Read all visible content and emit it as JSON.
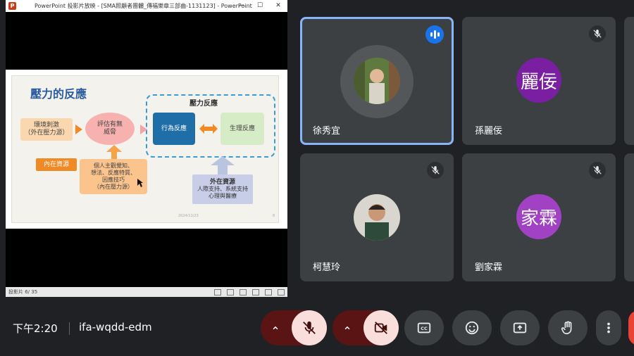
{
  "ppt": {
    "window_title": "PowerPoint 投影片放映 - [SMA照顧者團體_傳福樂章三部曲-1131123] - PowerPoint",
    "win_minimize": "—",
    "win_maximize": "☐",
    "win_close": "✕",
    "status_text": "投影片 6/ 35",
    "slide": {
      "title": "壓力的反應",
      "env_stimulus": "環境刺激\n（外在壓力源）",
      "evaluate": "評估有無\n威脅",
      "stress_response_label": "壓力反應",
      "behavior_response": "行為反應",
      "physio_response": "生理反應",
      "inner_resources_label": "內在資源",
      "personal": "個人主觀覺知、\n想法、反應特質、\n因應技巧\n（內在壓力源）",
      "external_title": "外在資源",
      "external_body": "人際支持、系統支持\n心理與醫療",
      "footer_date": "2024/11/23",
      "footer_page": "6"
    }
  },
  "tiles": [
    {
      "name": "徐秀宜",
      "speaking": true
    },
    {
      "name": "孫麗佞",
      "initials": "麗佞",
      "avatar_color": "#7b1fa2"
    },
    {
      "name": "柯慧玲"
    },
    {
      "name": "劉家霖",
      "initials": "家霖",
      "avatar_color": "#a142c4"
    }
  ],
  "bottom": {
    "clock": "下午2:20",
    "meeting_code": "ifa-wqdd-edm"
  },
  "icons": {
    "mic": "mic-off-icon",
    "cam": "videocam-off-icon",
    "cc": "closed-caption-icon",
    "emoji": "emoji-icon",
    "present": "present-screen-icon",
    "hand": "raise-hand-icon",
    "more": "more-vert-icon"
  },
  "colors": {
    "accent": "#8ab4f8",
    "active_speaker": "#1a73e8",
    "muted_ctrl_bg": "#f9dedc",
    "muted_ctrl_dark": "#5a1414",
    "tile_bg": "#3c4043",
    "page_bg": "#202124"
  }
}
